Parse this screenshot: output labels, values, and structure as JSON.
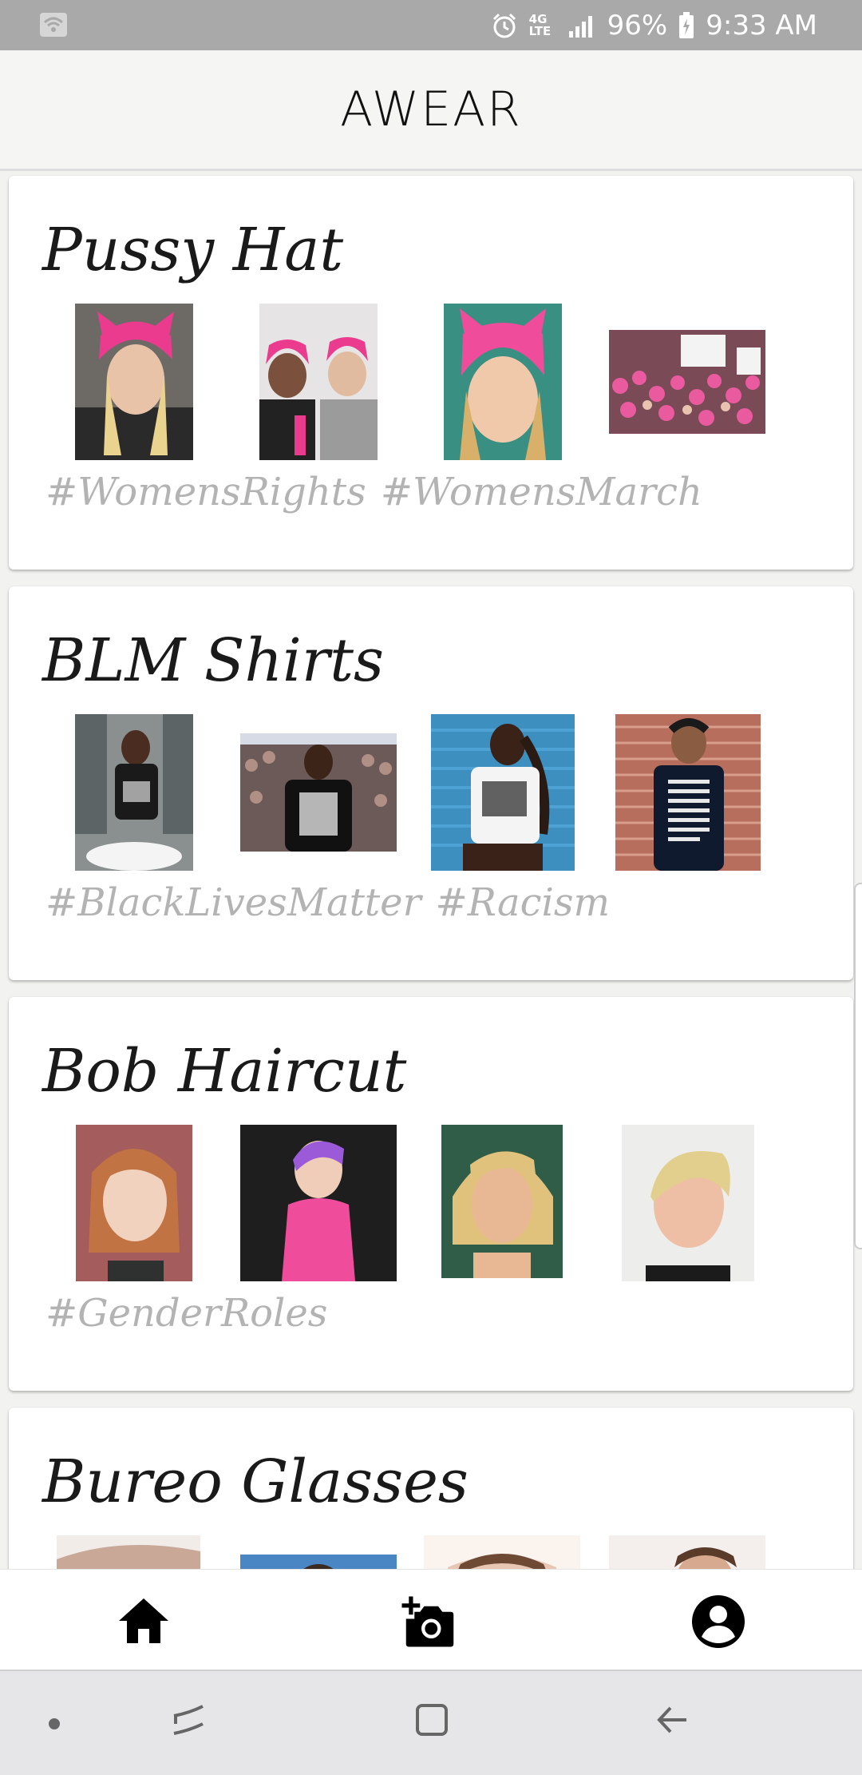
{
  "status_bar": {
    "battery": "96%",
    "time": "9:33 AM",
    "network": "4G LTE"
  },
  "app": {
    "title": "AWEAR"
  },
  "feed": [
    {
      "title": "Pussy Hat",
      "images": [
        "pink-knit-hat-selfie",
        "two-women-pink-hats",
        "pink-hat-smiling-woman",
        "march-crowd-pink-hats"
      ],
      "tags": [
        "#WomensRights",
        "#WomensMarch"
      ]
    },
    {
      "title": "BLM Shirts",
      "images": [
        "black-lives-matter-mirror-selfie",
        "black-lives-matter-rally-shirt",
        "black-lives-matter-white-tee",
        "names-tee-brick-wall"
      ],
      "tags": [
        "#BlackLivesMatter",
        "#Racism"
      ]
    },
    {
      "title": "Bob Haircut",
      "images": [
        "auburn-bob-portrait",
        "purple-pixie-pink-top",
        "blonde-bob-portrait",
        "blonde-pixie-portrait"
      ],
      "tags": [
        "#GenderRoles"
      ]
    },
    {
      "title": "Bureo Glasses",
      "images": [
        "glasses-photo-1",
        "glasses-photo-2",
        "glasses-photo-3",
        "glasses-photo-4"
      ],
      "tags": []
    }
  ],
  "bottom_nav": [
    {
      "icon": "home-icon"
    },
    {
      "icon": "add-photo-icon"
    },
    {
      "icon": "account-icon"
    }
  ],
  "colors": {
    "status_bar": "#a9a9a9",
    "tag_text": "#b3b3b3",
    "pink": "#ef4c9b"
  }
}
